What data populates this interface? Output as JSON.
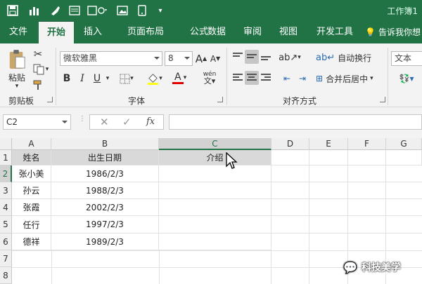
{
  "app": {
    "title": "工作簿1"
  },
  "tabs": [
    {
      "label": "文件",
      "active": false
    },
    {
      "label": "开始",
      "active": true
    },
    {
      "label": "插入",
      "active": false
    },
    {
      "label": "页面布局",
      "active": false
    },
    {
      "label": "公式",
      "active": false
    },
    {
      "label": "数据",
      "active": false
    },
    {
      "label": "审阅",
      "active": false
    },
    {
      "label": "视图",
      "active": false
    },
    {
      "label": "开发工具",
      "active": false
    }
  ],
  "tellme": "告诉我你想",
  "ribbon": {
    "clipboard": {
      "paste_label": "粘贴",
      "group_label": "剪贴板"
    },
    "font": {
      "font_name": "微软雅黑",
      "font_size": "8",
      "bold": "B",
      "italic": "I",
      "underline": "U",
      "grow": "A",
      "shrink": "A",
      "font_color_glyph": "A",
      "phonetic_glyph": "wén",
      "group_label": "字体",
      "font_color": "#e00000"
    },
    "alignment": {
      "wrap_text": "自动换行",
      "merge_center": "合并后居中",
      "group_label": "对齐方式"
    },
    "number": {
      "format": "文本"
    }
  },
  "formula_bar": {
    "name_box": "C2",
    "cancel": "✕",
    "enter": "✓",
    "fx": "fx",
    "content": ""
  },
  "columns": [
    "A",
    "B",
    "C",
    "D",
    "E",
    "F",
    "G"
  ],
  "rows": [
    "1",
    "2",
    "3",
    "4",
    "5",
    "6",
    "7",
    "8"
  ],
  "table": {
    "headers": [
      "姓名",
      "出生日期",
      "介绍"
    ],
    "data": [
      [
        "张小美",
        "1986/2/3",
        ""
      ],
      [
        "孙云",
        "1988/2/3",
        ""
      ],
      [
        "张霞",
        "2002/2/3",
        ""
      ],
      [
        "任行",
        "1997/2/3",
        ""
      ],
      [
        "德祥",
        "1989/2/3",
        ""
      ]
    ]
  },
  "watermark": "科技美学",
  "colors": {
    "brand": "#217346",
    "ribbon_bg": "#f3f3f3",
    "header_fill": "#d9d9d9"
  }
}
